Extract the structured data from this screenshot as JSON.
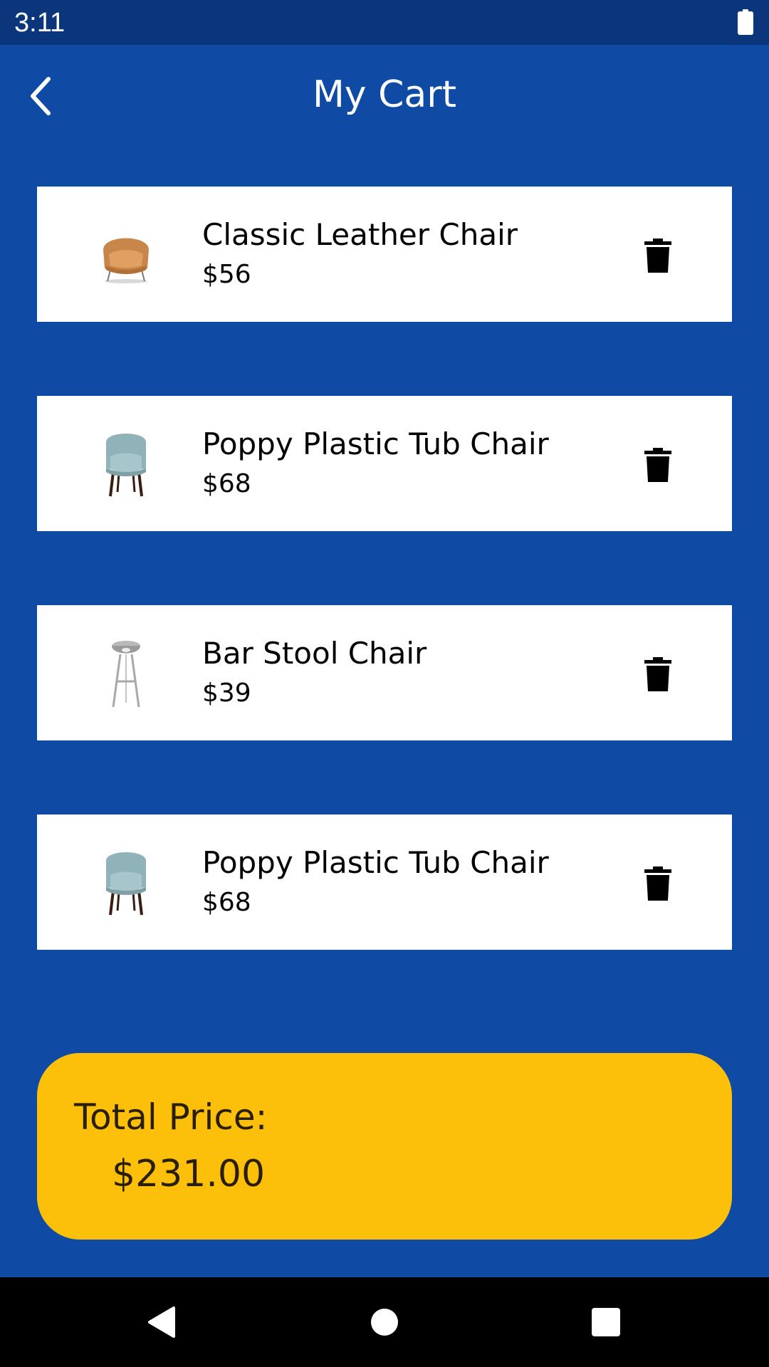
{
  "status_bar": {
    "time": "3:11",
    "battery_icon": "battery-full-icon"
  },
  "header": {
    "title": "My Cart",
    "back_icon": "chevron-left-icon"
  },
  "cart": {
    "items": [
      {
        "name": "Classic Leather Chair",
        "price": "$56",
        "image": "leather-armchair",
        "delete_icon": "trash-icon"
      },
      {
        "name": "Poppy Plastic Tub Chair",
        "price": "$68",
        "image": "tub-chair",
        "delete_icon": "trash-icon"
      },
      {
        "name": "Bar Stool Chair",
        "price": "$39",
        "image": "bar-stool",
        "delete_icon": "trash-icon"
      },
      {
        "name": "Poppy Plastic Tub Chair",
        "price": "$68",
        "image": "tub-chair",
        "delete_icon": "trash-icon"
      }
    ]
  },
  "total": {
    "label": "Total Price:",
    "value": "$231.00"
  },
  "nav_bar": {
    "back_icon": "triangle-back-icon",
    "home_icon": "circle-home-icon",
    "recents_icon": "square-recents-icon"
  },
  "colors": {
    "background": "#0f4aa4",
    "status_bar": "#0b367b",
    "card": "#ffffff",
    "total_card": "#fdc00a",
    "nav_bar": "#000000"
  }
}
